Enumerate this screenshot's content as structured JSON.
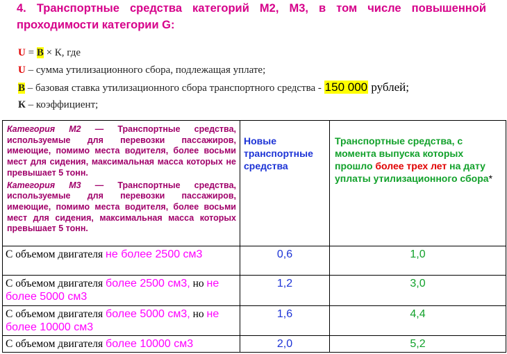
{
  "heading": {
    "title": "4. Транспортные средства категорий М2, М3, в том числе повышенной проходимости категории G:"
  },
  "formula": {
    "equation": {
      "u": "U",
      "eq": " = ",
      "b": "B",
      "rest": " × К, где"
    },
    "line_u": {
      "sym": "U",
      "text": " – сумма утилизационного сбора, подлежащая уплате;"
    },
    "line_b": {
      "sym": "B",
      "text": " – базовая ставка утилизационного сбора транспортного средства - ",
      "amount": "150 000",
      "unit": " рублей;"
    },
    "line_k": {
      "sym": "К",
      "text": " – коэффициент;"
    }
  },
  "table": {
    "categories": [
      {
        "name": "Категория М2",
        "text": " — Транспортные средства, используемые для перевозки пассажиров, имеющие, помимо места водителя, более восьми мест для сидения, максимальная масса которых не превышает 5 тонн."
      },
      {
        "name": "Категория М3",
        "text": " — Транспортные средства, используемые для перевозки пассажиров, имеющие, помимо места водителя, более восьми мест для сидения, максимальная масса которых превышает 5 тонн."
      }
    ],
    "col_new": "Новые транспортные средства",
    "col_old": {
      "part1": "Транспортные средства, с момента выпуска которых прошло ",
      "emph": "более трех лет",
      "part2": " на дату уплаты утилизационного сбора",
      "star": "*"
    },
    "rows": [
      {
        "prefix": "С объемом двигателя ",
        "cap1": "не более 2500 см3",
        "mid": "",
        "cap2": "",
        "new": "0,6",
        "old": "1,0"
      },
      {
        "prefix": "С объемом двигателя ",
        "cap1": "более 2500 см3,",
        "mid": " но ",
        "cap2": "не более 5000 см3",
        "new": "1,2",
        "old": "3,0"
      },
      {
        "prefix": "С объемом двигателя ",
        "cap1": "более 5000 см3,",
        "mid": " но ",
        "cap2": "не более 10000 см3",
        "new": "1,6",
        "old": "4,4"
      },
      {
        "prefix": "С объемом двигателя ",
        "cap1": "более 10000 см3",
        "mid": "",
        "cap2": "",
        "new": "2,0",
        "old": "5,2"
      }
    ]
  },
  "colors": {
    "heading": "#d6008a",
    "category_text": "#a0006a",
    "new_col": "#1c33d6",
    "old_col": "#12a12b",
    "emphasis": "#e00000",
    "capacity": "#ff00ff",
    "highlight": "#ffff00"
  }
}
